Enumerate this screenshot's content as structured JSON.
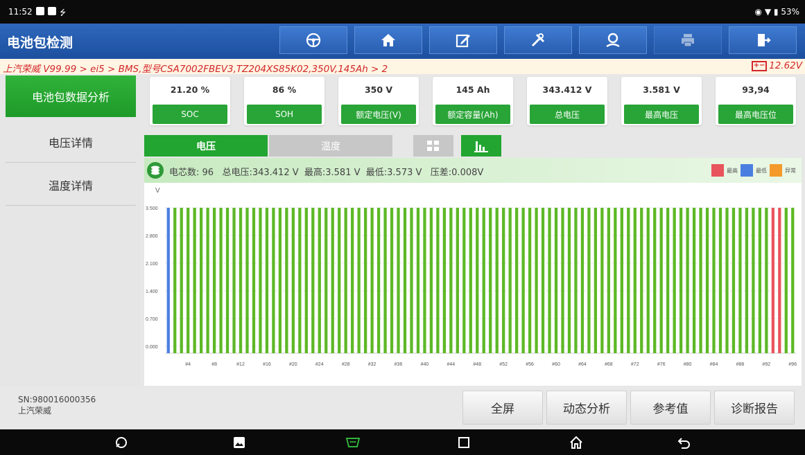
{
  "status": {
    "time": "11:52",
    "battery": "53%"
  },
  "app": {
    "title": "电池包检测"
  },
  "toolbar": [
    "steering-wheel-icon",
    "home-icon",
    "edit-icon",
    "tools-icon",
    "user-icon",
    "print-icon",
    "exit-icon"
  ],
  "breadcrumb": {
    "path": "上汽荣威 V99.99 > ei5  > BMS,型号CSA7002FBEV3,TZ204XS85K02,350V,145Ah > 2",
    "voltage": "12.62V"
  },
  "sidebar": {
    "items": [
      {
        "label": "电池包数据分析"
      },
      {
        "label": "电压详情"
      },
      {
        "label": "温度详情"
      }
    ]
  },
  "cards": [
    {
      "value": "21.20 %",
      "label": "SOC"
    },
    {
      "value": "86 %",
      "label": "SOH"
    },
    {
      "value": "350 V",
      "label": "额定电压(V)"
    },
    {
      "value": "145 Ah",
      "label": "额定容量(Ah)"
    },
    {
      "value": "343.412 V",
      "label": "总电压"
    },
    {
      "value": "3.581 V",
      "label": "最高电压"
    },
    {
      "value": "93,94",
      "label": "最高电压位"
    }
  ],
  "tabs": {
    "voltage": "电压",
    "temperature": "温度"
  },
  "info": {
    "text": "电芯数: 96   总电压:343.412 V  最高:3.581 V  最低:3.573 V   压差:0.008V",
    "legend": [
      {
        "label": "最高",
        "color": "#e8545c"
      },
      {
        "label": "最低",
        "color": "#4a7fe0"
      },
      {
        "label": "异常",
        "color": "#f39a2b"
      }
    ]
  },
  "chart_data": {
    "type": "bar",
    "ylabel": "V",
    "ylim": [
      0,
      3.5
    ],
    "y_ticks": [
      "0.000",
      "0.700",
      "1.400",
      "2.100",
      "2.800",
      "3.500"
    ],
    "x_tick_labels": [
      "#4",
      "#8",
      "#12",
      "#16",
      "#20",
      "#24",
      "#28",
      "#32",
      "#36",
      "#40",
      "#44",
      "#48",
      "#52",
      "#56",
      "#60",
      "#64",
      "#68",
      "#72",
      "#76",
      "#80",
      "#84",
      "#88",
      "#92",
      "#96"
    ],
    "cell_count": 96,
    "value": 3.5,
    "highest_cells": [
      93,
      94
    ],
    "lowest_cells": [
      1
    ],
    "colors": {
      "normal": "#5db826",
      "highest": "#e8545c",
      "lowest": "#4a7fe0"
    }
  },
  "footer": {
    "sn": "SN:980016000356",
    "brand": "上汽荣威",
    "buttons": [
      "全屏",
      "动态分析",
      "参考值",
      "诊断报告"
    ]
  }
}
